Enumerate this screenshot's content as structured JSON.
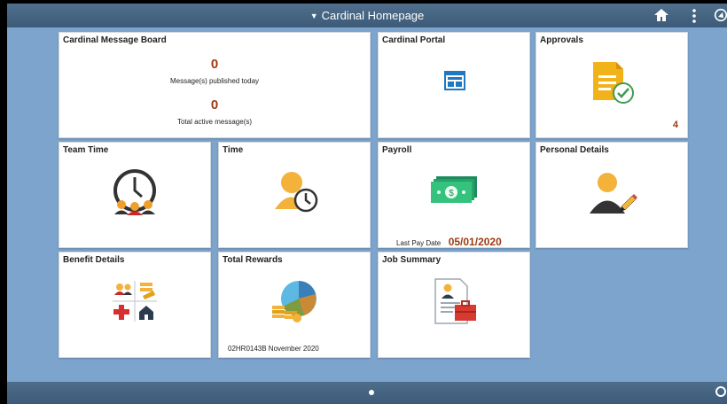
{
  "header": {
    "title": "Cardinal Homepage"
  },
  "tiles": {
    "message_board": {
      "title": "Cardinal Message Board",
      "published_count": "0",
      "published_label": "Message(s) published today",
      "active_count": "0",
      "active_label": "Total active message(s)"
    },
    "portal": {
      "title": "Cardinal Portal"
    },
    "approvals": {
      "title": "Approvals",
      "count": "4"
    },
    "team_time": {
      "title": "Team Time"
    },
    "time": {
      "title": "Time"
    },
    "payroll": {
      "title": "Payroll",
      "last_pay_label": "Last Pay Date",
      "last_pay_date": "05/01/2020"
    },
    "personal_details": {
      "title": "Personal Details"
    },
    "benefit_details": {
      "title": "Benefit Details"
    },
    "total_rewards": {
      "title": "Total Rewards",
      "statement": "02HR0143B November 2020"
    },
    "job_summary": {
      "title": "Job Summary"
    }
  },
  "colors": {
    "accent": "#9b3b12",
    "background": "#7da4cc",
    "header": "#3d5b78"
  },
  "icons": [
    "home-icon",
    "more-vertical-icon",
    "navbar-icon",
    "page-dot-icon"
  ]
}
